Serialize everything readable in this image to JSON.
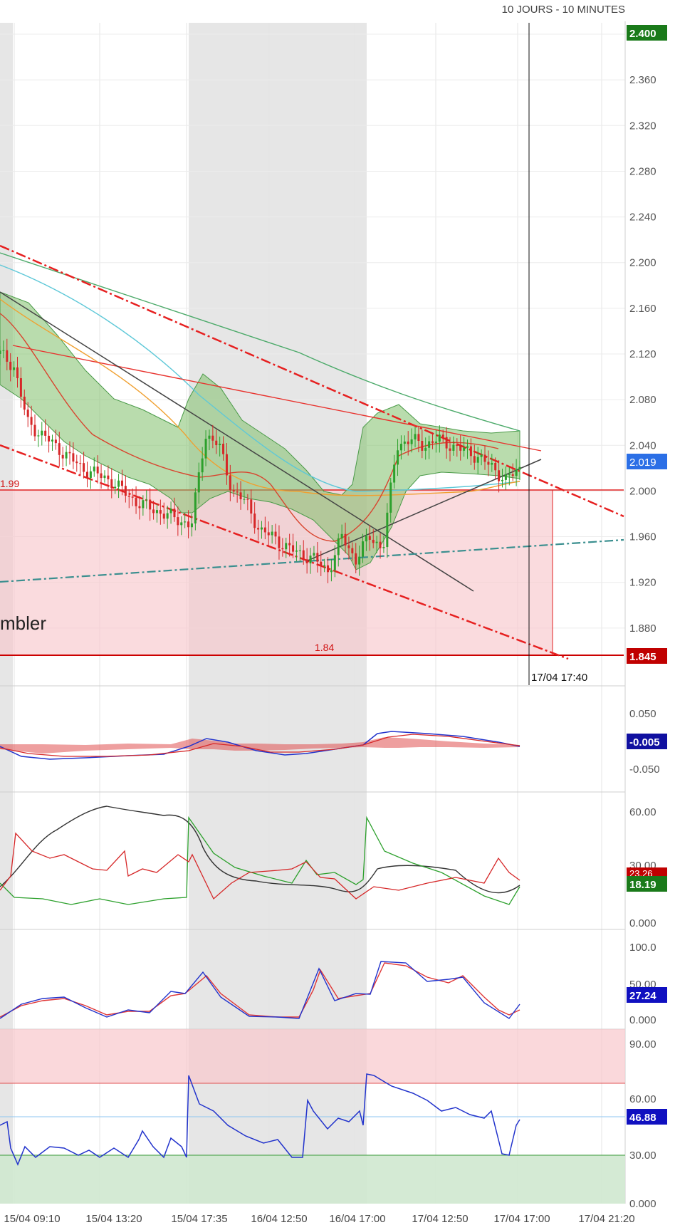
{
  "header": {
    "period_label": "10 JOURS - 10 MINUTES"
  },
  "colors": {
    "bull": "#2ca02c",
    "bear": "#d62728",
    "grid": "#e6e6e6",
    "shade": "#e6e6e6",
    "red_line": "#e8332e",
    "dash_red": "#e62020",
    "teal_dash": "#3a8f8f",
    "sma_cyan": "#5ec8d8",
    "sma_orange": "#f0a030",
    "sma_green": "#4caa6a",
    "boll_fill": "#7fbf6a",
    "blue": "#2233cc",
    "support_fill": "#f8c8cc",
    "oversold_fill": "#cfe8cf"
  },
  "chart_data": [
    {
      "type": "candlestick",
      "panel": "price",
      "ylim": [
        1.83,
        2.41
      ],
      "y_ticks": [
        "2.400",
        "2.360",
        "2.320",
        "2.280",
        "2.240",
        "2.200",
        "2.160",
        "2.120",
        "2.080",
        "2.040",
        "2.000",
        "1.960",
        "1.920",
        "1.880"
      ],
      "x_ticks": [
        "15/04 09:10",
        "15/04 13:20",
        "15/04 17:35",
        "16/04 12:50",
        "16/04 17:00",
        "17/04 12:50",
        "17/04 17:00",
        "17/04 21:20"
      ],
      "price_badges": {
        "top": "2.400",
        "last": "2.019",
        "bottom": "1.845"
      },
      "crosshair_label": "17/04 17:40",
      "level_labels": {
        "upper_level": "1.99",
        "lower_level": "1.84"
      },
      "annotation_text": "mbler",
      "close_path": [
        2.12,
        2.11,
        2.06,
        2.05,
        2.04,
        2.03,
        2.02,
        2.015,
        2.01,
        2.0,
        1.99,
        1.985,
        1.98,
        1.975,
        1.97,
        2.05,
        2.04,
        2.0,
        1.99,
        1.965,
        1.96,
        1.95,
        1.945,
        1.94,
        1.93,
        1.96,
        1.94,
        1.96,
        1.95,
        2.04,
        2.045,
        2.04,
        2.045,
        2.04,
        2.035,
        2.03,
        2.02,
        2.01,
        2.019
      ],
      "indicators": [
        "Bollinger bands",
        "SMA 20",
        "SMA 50",
        "SMA 100",
        "trend channel",
        "support zone 1.84–1.99"
      ]
    },
    {
      "type": "line",
      "panel": "MACD",
      "y_ticks": [
        "0.050",
        "-0.050"
      ],
      "last_value": "-0.005",
      "series": [
        {
          "values": [
            0.0,
            -0.008,
            -0.006,
            0.0,
            -0.002,
            0.01,
            0.003,
            -0.006,
            -0.008,
            0.0,
            0.015,
            0.008,
            0.004,
            -0.005
          ]
        }
      ]
    },
    {
      "type": "line",
      "panel": "DMI/ADX",
      "y_ticks": [
        "60.00",
        "30.00",
        "0.000"
      ],
      "last_values": [
        "23.26",
        "18.19"
      ],
      "series": [
        {
          "name": "+DI",
          "values": [
            18,
            10,
            12,
            14,
            20,
            55,
            30,
            25,
            22,
            34,
            28,
            58,
            30,
            24,
            18
          ]
        },
        {
          "name": "-DI",
          "values": [
            22,
            45,
            32,
            34,
            30,
            38,
            24,
            27,
            28,
            26,
            24,
            20,
            24,
            26,
            23
          ]
        },
        {
          "name": "ADX",
          "values": [
            20,
            38,
            47,
            42,
            44,
            42,
            38,
            30,
            25,
            20,
            20,
            28,
            26,
            20,
            21
          ]
        }
      ]
    },
    {
      "type": "line",
      "panel": "Stochastic",
      "y_ticks": [
        "100.0",
        "50.00",
        "0.000"
      ],
      "last_values": [
        "27.24"
      ],
      "series": [
        {
          "name": "%K",
          "values": [
            5,
            25,
            20,
            5,
            15,
            55,
            10,
            5,
            70,
            30,
            75,
            55,
            45,
            10,
            27.24
          ]
        },
        {
          "name": "%D",
          "values": [
            6,
            24,
            22,
            7,
            14,
            50,
            12,
            6,
            65,
            35,
            73,
            57,
            47,
            15,
            22
          ]
        }
      ]
    },
    {
      "type": "line",
      "panel": "RSI",
      "y_ticks": [
        "90.00",
        "60.00",
        "30.00",
        "0.000"
      ],
      "last_value": "46.88",
      "series": [
        {
          "name": "RSI",
          "values": [
            45,
            32,
            36,
            30,
            33,
            30,
            70,
            40,
            34,
            31,
            52,
            38,
            66,
            52,
            44,
            32,
            46.88
          ]
        }
      ]
    }
  ]
}
